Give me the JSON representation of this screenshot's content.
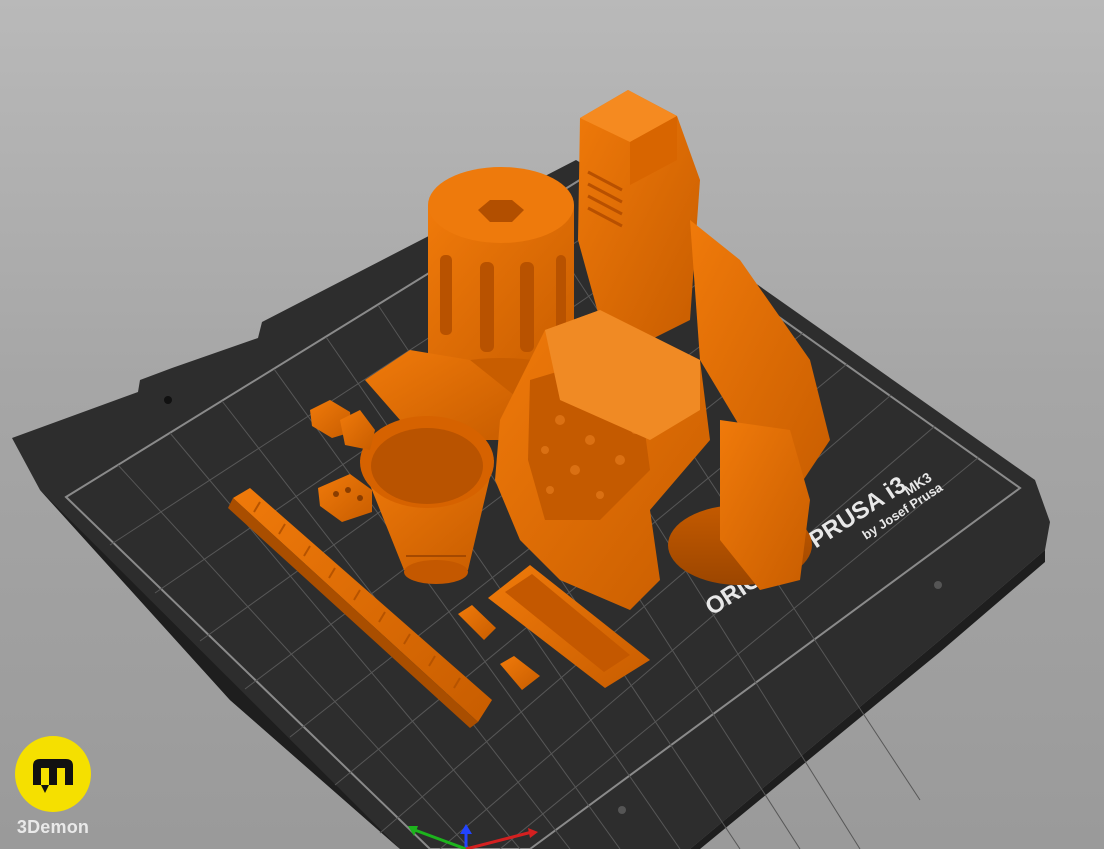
{
  "bed": {
    "brand_line": "ORIGINAL PRUSA i3",
    "model_suffix": "MK3",
    "byline": "by Josef Prusa"
  },
  "watermark": {
    "name": "3Demon"
  },
  "colors": {
    "background": "#a6a6a6",
    "bed": "#2f2f2f",
    "grid": "#5c5c5c",
    "model": "#e26b00",
    "model_shadow": "#b45200",
    "logo_yellow": "#f5e000"
  },
  "icons": {
    "logo": "3demon-logo-icon",
    "axes": "xyz-axes-icon"
  }
}
